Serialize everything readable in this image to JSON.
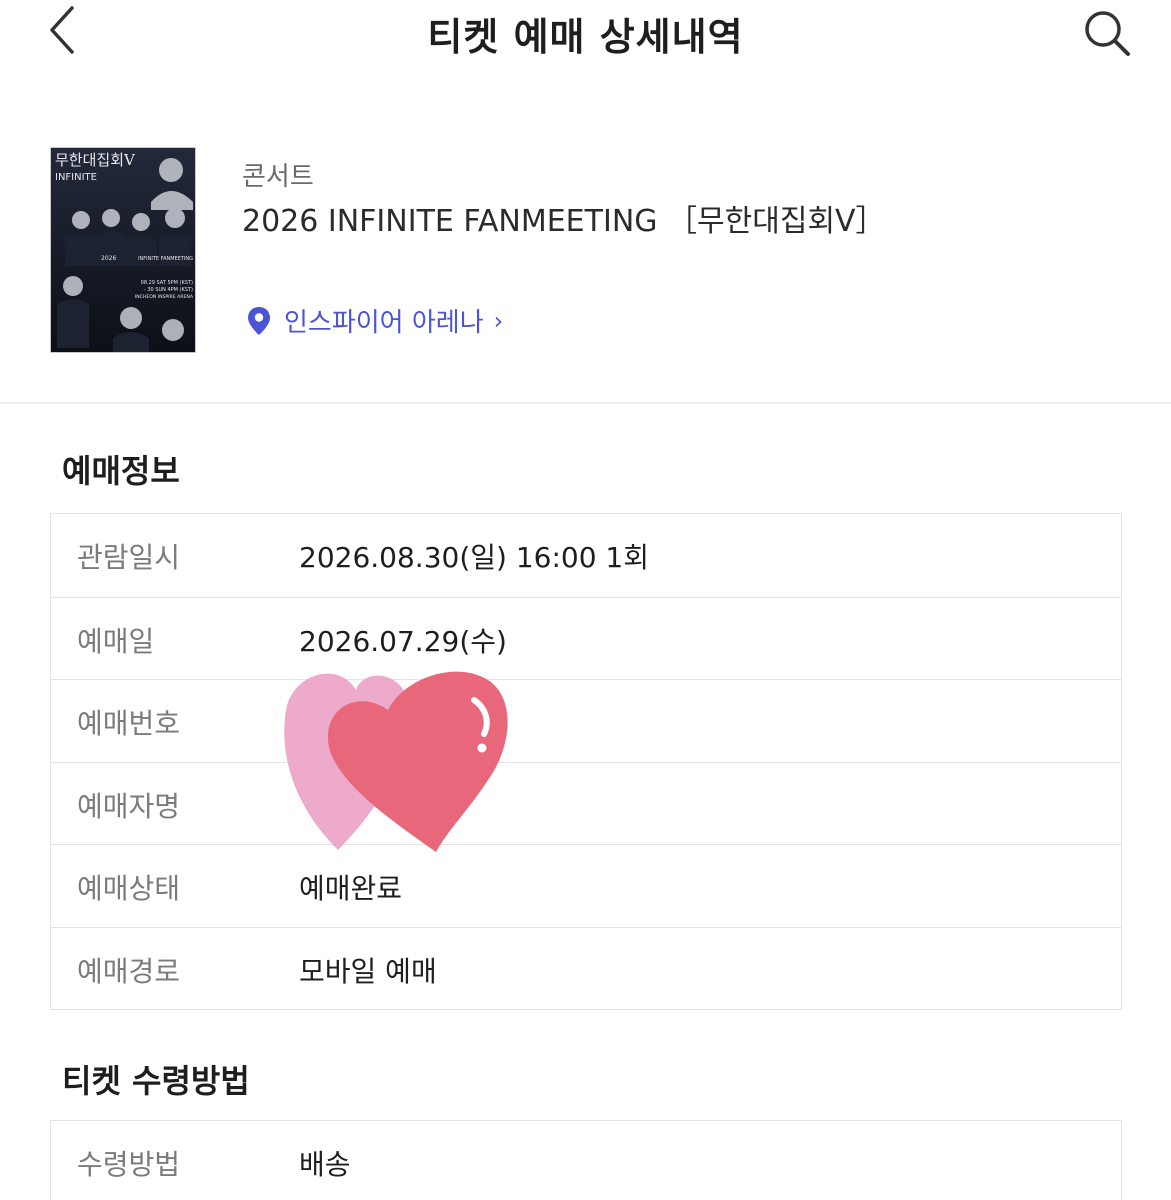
{
  "header": {
    "title": "티켓 예매 상세내역",
    "back_icon": "chevron-left-icon",
    "search_icon": "search-icon"
  },
  "event": {
    "category": "콘서트",
    "title": "2026 INFINITE FANMEETING ［무한대집회V］",
    "venue": "인스파이어 아레나",
    "venue_chevron": "›",
    "poster": {
      "title_text": "무한대집회V",
      "logo_text": "INFINITE",
      "year": "2026",
      "subtitle": "INFINITE FANMEETING",
      "date_line1": "08.29 SAT 5PM (KST)",
      "date_line2": "- 30 SUN 4PM (KST)",
      "venue_line": "INCHEON INSPIRE ARENA"
    }
  },
  "booking_section": {
    "title": "예매정보",
    "rows": [
      {
        "label": "관람일시",
        "value": "2026.08.30(일) 16:00 1회"
      },
      {
        "label": "예매일",
        "value": "2026.07.29(수)"
      },
      {
        "label": "예매번호",
        "value": ""
      },
      {
        "label": "예매자명",
        "value": ""
      },
      {
        "label": "예매상태",
        "value": "예매완료"
      },
      {
        "label": "예매경로",
        "value": "모바일 예매"
      }
    ]
  },
  "receipt_section": {
    "title": "티켓 수령방법",
    "rows": [
      {
        "label": "수령방법",
        "value": "배송"
      }
    ]
  },
  "colors": {
    "accent": "#4a55d6",
    "heart_back": "#eeaacb",
    "heart_front": "#e8677a"
  }
}
